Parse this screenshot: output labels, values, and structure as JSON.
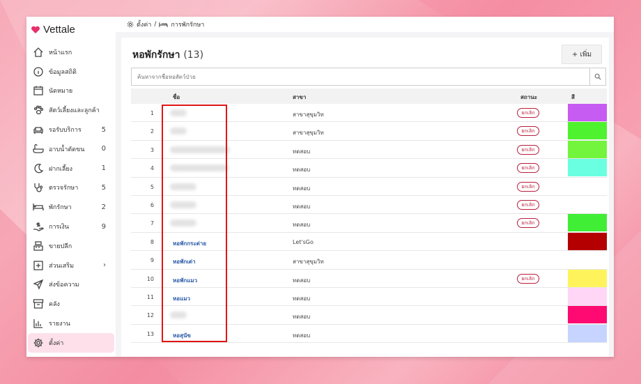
{
  "app": {
    "name": "Vettale"
  },
  "breadcrumb": {
    "settings": "ตั้งค่า",
    "separator": "/",
    "current": "การพักรักษา"
  },
  "sidebar": {
    "items": [
      {
        "key": "home",
        "label": "หน้าแรก",
        "count": "",
        "icon": "house-icon"
      },
      {
        "key": "stats",
        "label": "ข้อมูลสถิติ",
        "count": "",
        "icon": "info-icon"
      },
      {
        "key": "appointments",
        "label": "นัดหมาย",
        "count": "",
        "icon": "calendar-icon"
      },
      {
        "key": "pets",
        "label": "สัตว์เลี้ยงและลูกค้า",
        "count": "",
        "icon": "paw-icon"
      },
      {
        "key": "waiting",
        "label": "รอรับบริการ",
        "count": "5",
        "icon": "sofa-icon"
      },
      {
        "key": "grooming",
        "label": "อาบน้ำตัดขน",
        "count": "0",
        "icon": "bathtub-icon"
      },
      {
        "key": "boarding",
        "label": "ฝากเลี้ยง",
        "count": "1",
        "icon": "moon-icon"
      },
      {
        "key": "treatment",
        "label": "ตรวจรักษา",
        "count": "5",
        "icon": "stethoscope-icon"
      },
      {
        "key": "inpatient",
        "label": "พักรักษา",
        "count": "2",
        "icon": "bed-icon"
      },
      {
        "key": "finance",
        "label": "การเงิน",
        "count": "9",
        "icon": "money-hand-icon"
      },
      {
        "key": "retail",
        "label": "ขายปลีก",
        "count": "",
        "icon": "cash-register-icon"
      },
      {
        "key": "addons",
        "label": "ส่วนเสริม",
        "count": "›",
        "icon": "plus-square-icon"
      },
      {
        "key": "messages",
        "label": "ส่งข้อความ",
        "count": "",
        "icon": "send-icon"
      },
      {
        "key": "warehouse",
        "label": "คลัง",
        "count": "",
        "icon": "archive-icon"
      },
      {
        "key": "reports",
        "label": "รายงาน",
        "count": "",
        "icon": "bar-chart-icon"
      },
      {
        "key": "settings",
        "label": "ตั้งค่า",
        "count": "",
        "icon": "gear-icon",
        "active": true
      }
    ]
  },
  "main": {
    "title": "หอพักรักษา",
    "count": "(13)",
    "add_label": "+ เพิ่ม",
    "search_placeholder": "ค้นหาจากชื่อหอสัตว์ป่วย",
    "columns": {
      "name": "ชื่อ",
      "branch": "สาขา",
      "status": "สถานะ",
      "color": "สี"
    },
    "badge_label": "ยกเลิก",
    "rows": [
      {
        "num": "1",
        "name": "",
        "blur_width": 24,
        "branch": "สาขาสุขุมวิท",
        "cancelled": true,
        "color": "#c65cf2"
      },
      {
        "num": "2",
        "name": "",
        "blur_width": 24,
        "branch": "สาขาสุขุมวิท",
        "cancelled": true,
        "color": "#4ff22e"
      },
      {
        "num": "3",
        "name": "",
        "blur_width": 86,
        "branch": "ทดสอบ",
        "cancelled": true,
        "color": "#72f53c"
      },
      {
        "num": "4",
        "name": "",
        "blur_width": 84,
        "branch": "ทดสอบ",
        "cancelled": true,
        "color": "#6affe0"
      },
      {
        "num": "5",
        "name": "",
        "blur_width": 38,
        "branch": "ทดสอบ",
        "cancelled": true,
        "color": ""
      },
      {
        "num": "6",
        "name": "",
        "blur_width": 38,
        "branch": "ทดสอบ",
        "cancelled": true,
        "color": ""
      },
      {
        "num": "7",
        "name": "",
        "blur_width": 38,
        "branch": "ทดสอบ",
        "cancelled": true,
        "color": "#40ee36"
      },
      {
        "num": "8",
        "name": "หอพักกระต่าย",
        "blur_width": 0,
        "branch": "Let'sGo",
        "cancelled": false,
        "color": "#b40000"
      },
      {
        "num": "9",
        "name": "หอพักเต่า",
        "blur_width": 0,
        "branch": "สาขาสุขุมวิท",
        "cancelled": false,
        "color": ""
      },
      {
        "num": "10",
        "name": "หอพักแมว",
        "blur_width": 0,
        "branch": "ทดสอบ",
        "cancelled": true,
        "color": "#fff35c"
      },
      {
        "num": "11",
        "name": "หอแมว",
        "blur_width": 0,
        "branch": "ทดสอบ",
        "cancelled": false,
        "color": "#ffd6f6"
      },
      {
        "num": "12",
        "name": "",
        "blur_width": 24,
        "branch": "ทดสอบ",
        "cancelled": false,
        "color": "#ff0a72"
      },
      {
        "num": "13",
        "name": "หอสุนัข",
        "blur_width": 0,
        "branch": "ทดสอบ",
        "cancelled": false,
        "color": "#c6d4ff"
      }
    ]
  },
  "colors": {
    "accent": "#e8306a",
    "active_bg": "#fde0ea",
    "badge": "#b81c3a",
    "highlight": "#e01414"
  }
}
